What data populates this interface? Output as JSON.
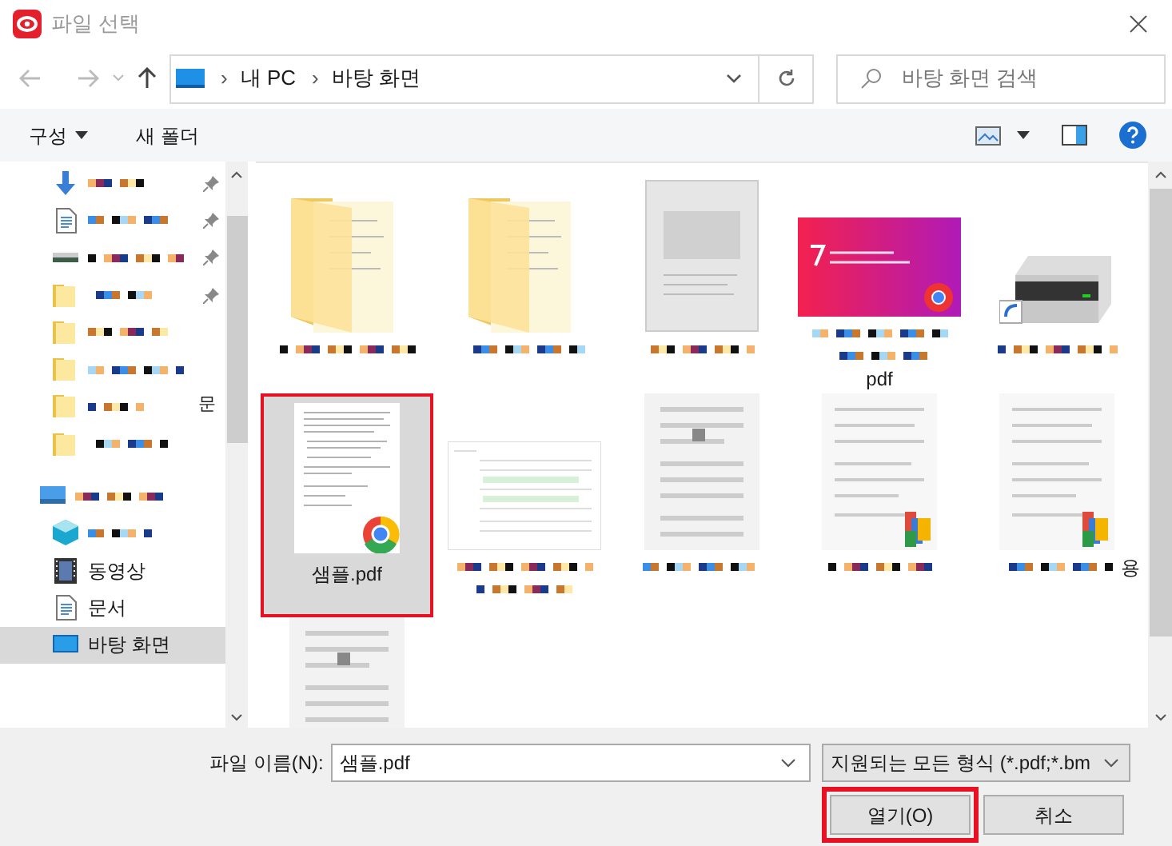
{
  "window": {
    "title": "파일 선택"
  },
  "address": {
    "separator": "›",
    "crumbs": [
      "내 PC",
      "바탕 화면"
    ]
  },
  "search": {
    "placeholder": "바탕 화면 검색"
  },
  "toolbar": {
    "organize": "구성",
    "new_folder": "새 폴더"
  },
  "sidebar": {
    "items": [
      {
        "kind": "download",
        "pixelated": true,
        "pinned": true,
        "selected": false
      },
      {
        "kind": "doc",
        "pixelated": true,
        "pinned": true,
        "selected": false
      },
      {
        "kind": "drive",
        "pixelated": true,
        "pinned": true,
        "selected": false
      },
      {
        "kind": "folder",
        "pixelated": true,
        "pinned": true,
        "selected": false
      },
      {
        "kind": "folder",
        "pixelated": true,
        "pinned": false,
        "selected": false
      },
      {
        "kind": "folder",
        "pixelated": true,
        "pinned": false,
        "selected": false
      },
      {
        "kind": "folder",
        "pixelated": true,
        "pinned": false,
        "selected": false,
        "overflow": "문"
      },
      {
        "kind": "folder",
        "pixelated": true,
        "pinned": false,
        "selected": false
      },
      {
        "kind": "pc",
        "pixelated": true,
        "pinned": false,
        "selected": false
      },
      {
        "kind": "cube",
        "pixelated": true,
        "pinned": false,
        "selected": false
      },
      {
        "kind": "video",
        "label": "동영상",
        "pinned": false,
        "selected": false
      },
      {
        "kind": "doc",
        "label": "문서",
        "pinned": false,
        "selected": false
      },
      {
        "kind": "desktop",
        "label": "바탕 화면",
        "pinned": false,
        "selected": true
      }
    ]
  },
  "files": [
    {
      "kind": "folder",
      "pixelated": true,
      "selected": false
    },
    {
      "kind": "folder",
      "pixelated": true,
      "selected": false
    },
    {
      "kind": "image",
      "pixelated": true,
      "selected": false
    },
    {
      "kind": "promo",
      "pixelated": true,
      "tail": "pdf",
      "selected": false
    },
    {
      "kind": "drive",
      "pixelated": true,
      "selected": false
    },
    {
      "kind": "pdf",
      "label": "샘플.pdf",
      "selected": true
    },
    {
      "kind": "sheet",
      "pixelated": true,
      "selected": false
    },
    {
      "kind": "page",
      "pixelated": true,
      "selected": false
    },
    {
      "kind": "page-app",
      "pixelated": true,
      "selected": false
    },
    {
      "kind": "page-app",
      "pixelated": true,
      "tail": "용",
      "selected": false
    },
    {
      "kind": "page",
      "selected": false
    }
  ],
  "footer": {
    "filename_label": "파일 이름(N):",
    "filename": "샘플.pdf",
    "filter": "지원되는 모든 형식 (*.pdf;*.bm",
    "open": {
      "label": "열기(O)",
      "highlighted": true
    },
    "cancel": "취소"
  }
}
